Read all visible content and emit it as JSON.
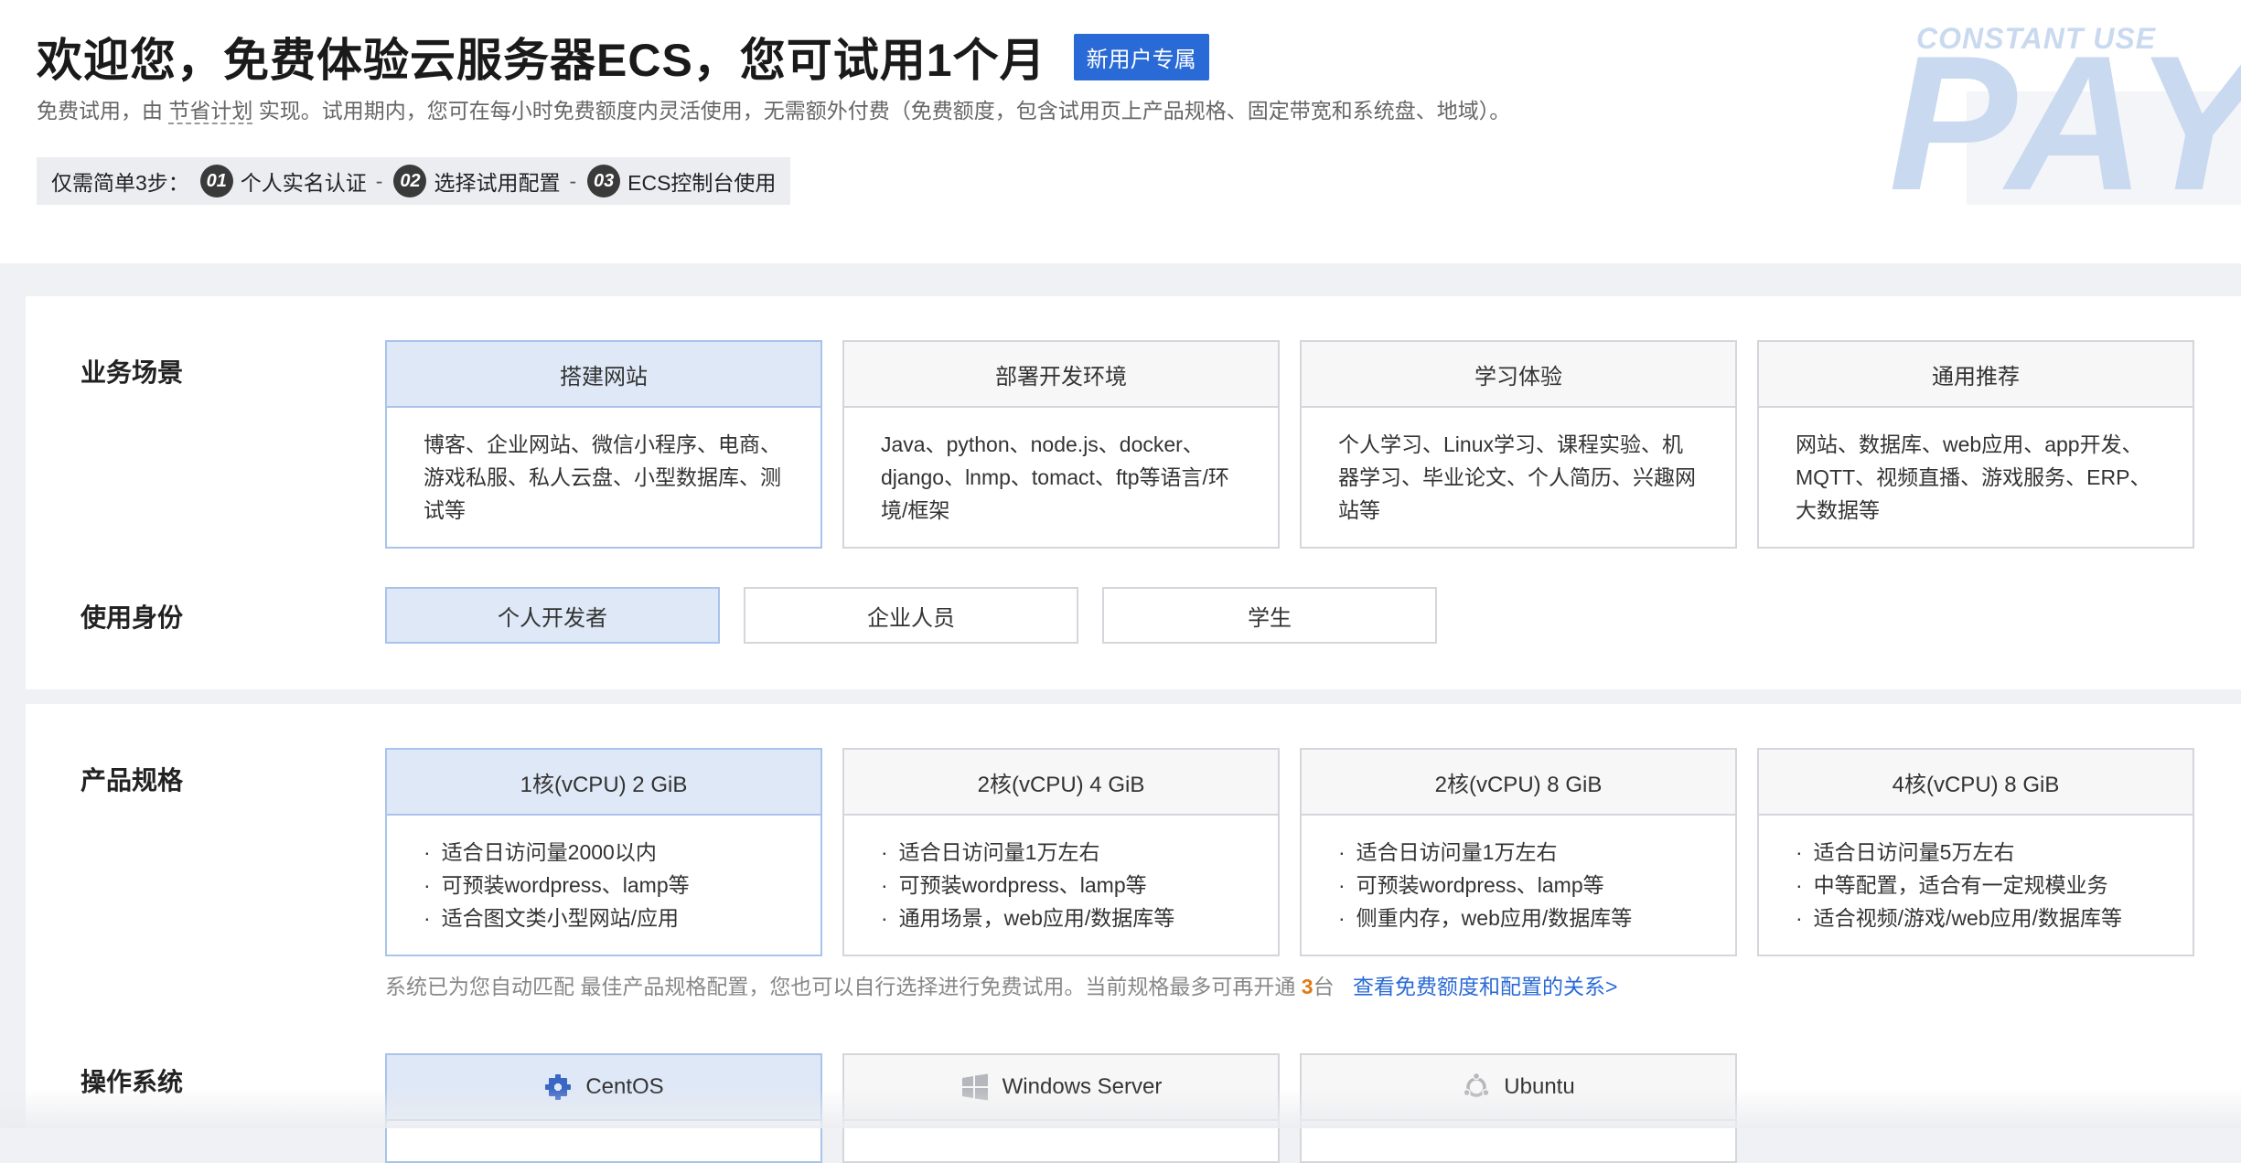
{
  "header": {
    "title": "欢迎您，免费体验云服务器ECS，您可试用1个月",
    "badge": "新用户专属",
    "subtitle_pre": "免费试用，由",
    "subtitle_link": "节省计划",
    "subtitle_post": "实现。试用期内，您可在每小时免费额度内灵活使用，无需额外付费（免费额度，包含试用页上产品规格、固定带宽和系统盘、地域）。",
    "steps_label": "仅需简单3步：",
    "steps": [
      {
        "num": "01",
        "label": "个人实名认证"
      },
      {
        "num": "02",
        "label": "选择试用配置"
      },
      {
        "num": "03",
        "label": "ECS控制台使用"
      }
    ],
    "separator": "-",
    "decor_small": "CONSTANT USE",
    "decor_big": "PAY"
  },
  "scenario": {
    "label": "业务场景",
    "options": [
      {
        "title": "搭建网站",
        "desc": "博客、企业网站、微信小程序、电商、游戏私服、私人云盘、小型数据库、测试等",
        "selected": true
      },
      {
        "title": "部署开发环境",
        "desc": "Java、python、node.js、docker、django、lnmp、tomact、ftp等语言/环境/框架",
        "selected": false
      },
      {
        "title": "学习体验",
        "desc": "个人学习、Linux学习、课程实验、机器学习、毕业论文、个人简历、兴趣网站等",
        "selected": false
      },
      {
        "title": "通用推荐",
        "desc": "网站、数据库、web应用、app开发、MQTT、视频直播、游戏服务、ERP、大数据等",
        "selected": false
      }
    ]
  },
  "identity": {
    "label": "使用身份",
    "options": [
      "个人开发者",
      "企业人员",
      "学生"
    ]
  },
  "spec": {
    "label": "产品规格",
    "options": [
      {
        "title": "1核(vCPU) 2 GiB",
        "bullets": [
          "适合日访问量2000以内",
          "可预装wordpress、lamp等",
          "适合图文类小型网站/应用"
        ]
      },
      {
        "title": "2核(vCPU) 4 GiB",
        "bullets": [
          "适合日访问量1万左右",
          "可预装wordpress、lamp等",
          "通用场景，web应用/数据库等"
        ]
      },
      {
        "title": "2核(vCPU) 8 GiB",
        "bullets": [
          "适合日访问量1万左右",
          "可预装wordpress、lamp等",
          "侧重内存，web应用/数据库等"
        ]
      },
      {
        "title": "4核(vCPU) 8 GiB",
        "bullets": [
          "适合日访问量5万左右",
          "中等配置，适合有一定规模业务",
          "适合视频/游戏/web应用/数据库等"
        ]
      }
    ],
    "note_pre": "系统已为您自动匹配 最佳产品规格配置，您也可以自行选择进行免费试用。当前规格最多可再开通",
    "note_num": "3",
    "note_unit": "台",
    "note_link": "查看免费额度和配置的关系>"
  },
  "os": {
    "label": "操作系统",
    "options": [
      {
        "name": "CentOS",
        "icon": "centos-icon"
      },
      {
        "name": "Windows Server",
        "icon": "windows-icon"
      },
      {
        "name": "Ubuntu",
        "icon": "ubuntu-icon"
      }
    ]
  },
  "colors": {
    "accent": "#2a6ad6",
    "selected_bg": "#dfe8f6",
    "highlight_num": "#e07a16"
  }
}
